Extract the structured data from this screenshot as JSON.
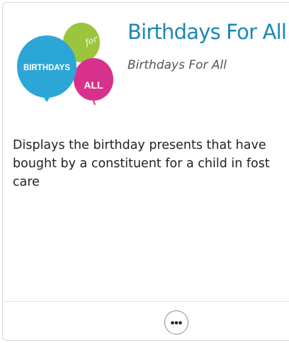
{
  "card": {
    "title": "Birthdays For All",
    "publisher": "Birthdays For All",
    "logo": {
      "balloon_top_text": "for",
      "balloon_left_text": "BIRTHDAYS",
      "balloon_right_text": "ALL",
      "colors": {
        "green": "#9bc53d",
        "blue": "#2ca6d6",
        "magenta": "#d8318c"
      }
    },
    "description_lines": [
      "Displays the birthday presents that have",
      "bought by a constituent for a child in fost",
      "care"
    ],
    "more_button_icon": "more-horizontal-icon"
  },
  "colors": {
    "title": "#1c88b8",
    "publisher": "#555555",
    "description": "#222222",
    "border": "#d9d9d9"
  }
}
